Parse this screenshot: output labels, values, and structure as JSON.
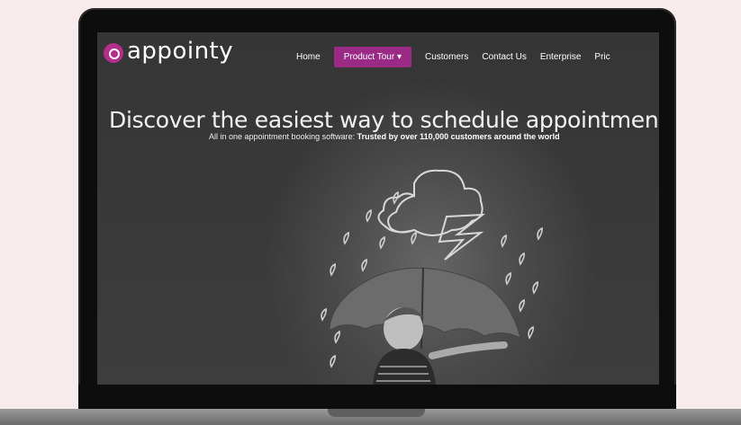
{
  "site": {
    "logo_text": "appointy",
    "nav": [
      {
        "label": "Home"
      },
      {
        "label": "Product Tour ▾"
      },
      {
        "label": "Customers"
      },
      {
        "label": "Contact Us"
      },
      {
        "label": "Enterprise"
      },
      {
        "label": "Pric"
      }
    ],
    "headline": "Discover the easiest way to schedule appointments wit",
    "subline_prefix": "All in one appointment booking software: ",
    "subline_bold": "Trusted by over 110,000 customers around the world"
  },
  "colors": {
    "brand": "#9a2a86",
    "background": "#f7eceb",
    "screen": "#3a3a3a"
  },
  "icons": [
    "appointy-logo-icon",
    "cloud-icon",
    "lightning-icon",
    "raindrop-icon",
    "umbrella-icon"
  ]
}
